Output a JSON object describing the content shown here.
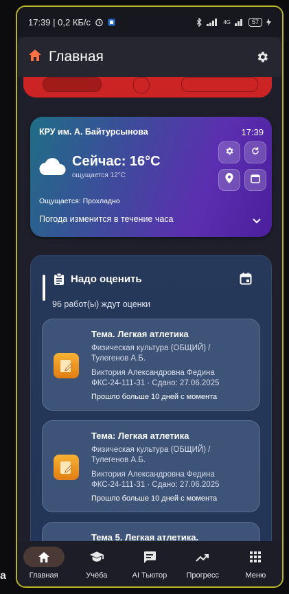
{
  "status_bar": {
    "time_speed": "17:39 | 0,2 КБ/с",
    "network_label": "4G",
    "battery": "57"
  },
  "app_bar": {
    "title": "Главная"
  },
  "weather": {
    "place": "КРУ им. А. Байтурсынова",
    "time": "17:39",
    "now": "Сейчас: 16°C",
    "feels_small": "ощущается 12°C",
    "feels": "Ощущается: Прохладно",
    "change": "Погода изменится в течение часа"
  },
  "grading": {
    "title": "Надо оценить",
    "count": "96 работ(ы) ждут оценки",
    "tasks": [
      {
        "title": "Тема. Легкая атлетика",
        "subject1": "Физическая культура (ОБЩИЙ) /",
        "subject2": "Тулегенов А.Б.",
        "student": "Виктория Александровна Федина",
        "group_date": "ФКС-24-111-31 · Сдано: 27.06.2025",
        "note": "Прошло больше 10 дней с момента"
      },
      {
        "title": "Тема: Легкая атлетика",
        "subject1": "Физическая культура (ОБЩИЙ) /",
        "subject2": "Тулегенов А.Б.",
        "student": "Виктория Александровна Федина",
        "group_date": "ФКС-24-111-31 · Сдано: 27.06.2025",
        "note": "Прошло больше 10 дней с момента"
      },
      {
        "title": "Тема 5. Легкая атлетика.",
        "subject1": "",
        "subject2": "",
        "student": "",
        "group_date": "",
        "note": ""
      }
    ]
  },
  "nav": {
    "items": [
      {
        "label": "Главная",
        "icon": "home-icon",
        "active": true
      },
      {
        "label": "Учёба",
        "icon": "graduation-cap-icon",
        "active": false
      },
      {
        "label": "AI Тьютор",
        "icon": "chat-icon",
        "active": false
      },
      {
        "label": "Прогресс",
        "icon": "trend-icon",
        "active": false
      },
      {
        "label": "Меню",
        "icon": "grid-menu-icon",
        "active": false
      }
    ]
  },
  "stray_text": "a",
  "colors": {
    "frame_border": "#b9b62a",
    "red_card": "#cc2424",
    "task_icon": "#f0a020",
    "nav_active_bg": "#4a3934"
  }
}
